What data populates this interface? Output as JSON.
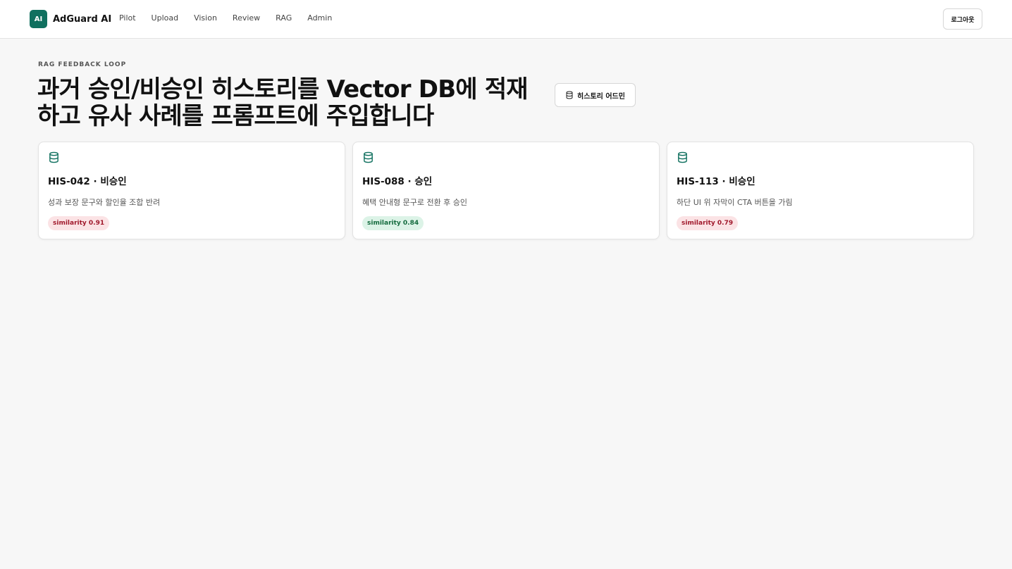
{
  "brand": {
    "logo_text": "AI",
    "name": "AdGuard AI"
  },
  "nav": [
    "Pilot",
    "Upload",
    "Vision",
    "Review",
    "RAG",
    "Admin"
  ],
  "header": {
    "logout_label": "로그아웃"
  },
  "page": {
    "eyebrow": "RAG FEEDBACK LOOP",
    "title": "과거 승인/비승인 히스토리를 Vector DB에 적재하고 유사 사례를 프롬프트에 주입합니다",
    "history_button_label": "히스토리 어드민"
  },
  "cards": [
    {
      "title": "HIS-042 · 비승인",
      "description": "성과 보장 문구와 할인율 조합 반려",
      "similarity": "similarity 0.91",
      "status": "reject"
    },
    {
      "title": "HIS-088 · 승인",
      "description": "혜택 안내형 문구로 전환 후 승인",
      "similarity": "similarity 0.84",
      "status": "approve"
    },
    {
      "title": "HIS-113 · 비승인",
      "description": "하단 UI 위 자막이 CTA 버튼을 가림",
      "similarity": "similarity 0.79",
      "status": "reject"
    }
  ],
  "colors": {
    "accent": "#10705f",
    "reject_bg": "#fbe3e5",
    "reject_text": "#a0182b",
    "approve_bg": "#dcf3e7",
    "approve_text": "#136a3d"
  },
  "icons": {
    "card_icon": "database-icon",
    "history_button_icon": "database-icon"
  }
}
